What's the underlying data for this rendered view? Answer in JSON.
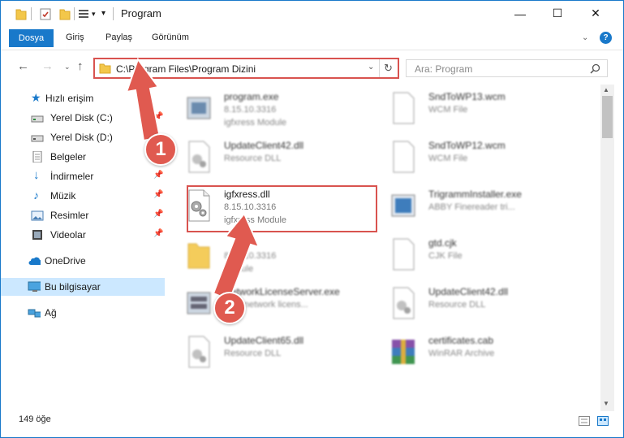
{
  "window": {
    "title": "Program",
    "minimize": "—",
    "maximize": "☐",
    "close": "✕"
  },
  "ribbon": {
    "file_tab": "Dosya",
    "tabs": [
      "Giriş",
      "Paylaş",
      "Görünüm"
    ]
  },
  "nav": {
    "address": "C:\\Program Files\\Program Dizini",
    "search_placeholder": "Ara: Program"
  },
  "sidebar": {
    "items": [
      {
        "label": "Hızlı erişim",
        "icon": "star-icon",
        "pinned": false
      },
      {
        "label": "Yerel Disk (C:)",
        "icon": "drive-icon",
        "pinned": true
      },
      {
        "label": "Yerel Disk (D:)",
        "icon": "drive-icon",
        "pinned": false
      },
      {
        "label": "Belgeler",
        "icon": "documents-icon",
        "pinned": true
      },
      {
        "label": "İndirmeler",
        "icon": "download-icon",
        "pinned": true
      },
      {
        "label": "Müzik",
        "icon": "music-icon",
        "pinned": true
      },
      {
        "label": "Resimler",
        "icon": "pictures-icon",
        "pinned": true
      },
      {
        "label": "Videolar",
        "icon": "video-icon",
        "pinned": true
      },
      {
        "label": "OneDrive",
        "icon": "cloud-icon",
        "pinned": false
      },
      {
        "label": "Bu bilgisayar",
        "icon": "computer-icon",
        "pinned": false
      },
      {
        "label": "Ağ",
        "icon": "network-icon",
        "pinned": false
      }
    ]
  },
  "files": [
    {
      "name": "program.exe",
      "line2": "8.15.10.3316",
      "line3": "igfxress Module",
      "icon": "exe-icon"
    },
    {
      "name": "SndToWP13.wcm",
      "line2": "WCM File",
      "line3": "",
      "icon": "blank-file-icon"
    },
    {
      "name": "UpdateClient42.dll",
      "line2": "Resource DLL",
      "line3": "",
      "icon": "dll-icon"
    },
    {
      "name": "SndToWP12.wcm",
      "line2": "WCM File",
      "line3": "",
      "icon": "blank-file-icon"
    },
    {
      "name": "igfxress.dll",
      "line2": "8.15.10.3316",
      "line3": "igfxress Module",
      "icon": "dll-icon"
    },
    {
      "name": "TrigrammInstaller.exe",
      "line2": "ABBY Finereader tri...",
      "line3": "",
      "icon": "installer-icon"
    },
    {
      "name": "",
      "line2": "8.15.10.3316",
      "line3": "Module",
      "icon": "folder-icon"
    },
    {
      "name": "gtd.cjk",
      "line2": "CJK File",
      "line3": "",
      "icon": "blank-file-icon"
    },
    {
      "name": "NetworkLicenseServer.exe",
      "line2": "BBY network licens...",
      "line3": "",
      "icon": "server-icon"
    },
    {
      "name": "UpdateClient42.dll",
      "line2": "Resource DLL",
      "line3": "",
      "icon": "dll-icon"
    },
    {
      "name": "UpdateClient65.dll",
      "line2": "Resource DLL",
      "line3": "",
      "icon": "dll-icon"
    },
    {
      "name": "certificates.cab",
      "line2": "WinRAR Archive",
      "line3": "",
      "icon": "archive-icon"
    }
  ],
  "annotations": {
    "step1": "1",
    "step2": "2",
    "colors": {
      "accent": "#1979ca",
      "marker": "#e05a50"
    }
  },
  "status": {
    "count": "149 öğe"
  }
}
